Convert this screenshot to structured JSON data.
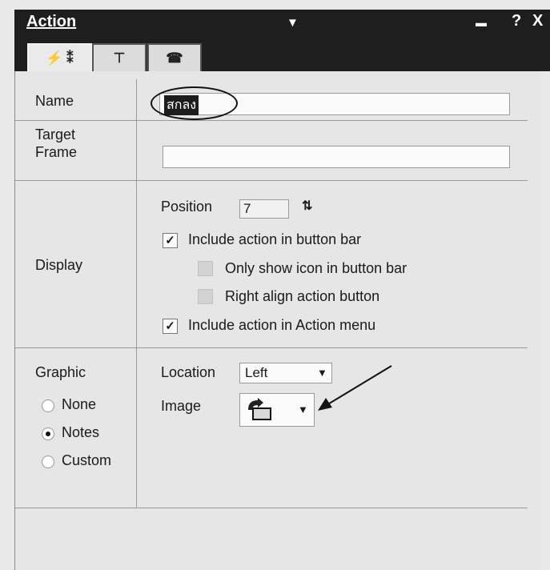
{
  "window": {
    "title": "Action"
  },
  "title_controls": {
    "dropdown": "▼",
    "minimize": "▬",
    "help": "?",
    "close": "X"
  },
  "tabs": [
    {
      "label": "⚡ ⁑",
      "icon": "lightning-icon"
    },
    {
      "label": "⊤",
      "icon": "button-bar-icon"
    },
    {
      "label": "☎",
      "icon": "phone-icon"
    }
  ],
  "form": {
    "name": {
      "label": "Name",
      "value": "สกลง"
    },
    "target_frame": {
      "label_line1": "Target",
      "label_line2": "Frame",
      "value": ""
    },
    "display": {
      "label": "Display",
      "position_label": "Position",
      "position_value": "7",
      "include_button_bar": {
        "label": "Include action in button bar",
        "checked": true,
        "mark": "✓"
      },
      "only_icon": {
        "label": "Only show icon in button bar",
        "checked": false
      },
      "right_align": {
        "label": "Right align action button",
        "checked": false
      },
      "include_action_menu": {
        "label": "Include action in Action menu",
        "checked": true,
        "mark": "✓"
      }
    },
    "graphic": {
      "label": "Graphic",
      "options": [
        "None",
        "Notes",
        "Custom"
      ],
      "selected": "Notes",
      "location_label": "Location",
      "location_value": "Left",
      "image_label": "Image"
    }
  },
  "colors": {
    "titlebar": "#1e1e1e",
    "panel": "#e6e6e6",
    "field": "#fbfbfb"
  }
}
